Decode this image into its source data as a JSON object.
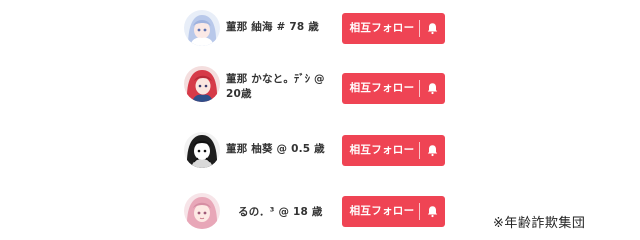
{
  "users": [
    {
      "name": "菫那 紬海 # 78 歳",
      "follow_label": "相互フォロー",
      "avatar_icon": "avatar-anime-girl-blue-hair-icon"
    },
    {
      "name": "菫那 かなと。ﾃﾞｼ @ 20歳",
      "follow_label": "相互フォロー",
      "avatar_icon": "avatar-anime-girl-red-hair-icon"
    },
    {
      "name": "菫那 柚葵 @ 0.5 歳",
      "follow_label": "相互フォロー",
      "avatar_icon": "avatar-manga-girl-monochrome-icon"
    },
    {
      "name": "るの．³ @ 18 歳",
      "follow_label": "相互フォロー",
      "avatar_icon": "avatar-anime-girl-pink-hair-icon"
    }
  ],
  "notification_icon": "bell-icon",
  "caption": "※年齢詐欺集団",
  "colors": {
    "button": "#ef4454",
    "text": "#333333"
  }
}
